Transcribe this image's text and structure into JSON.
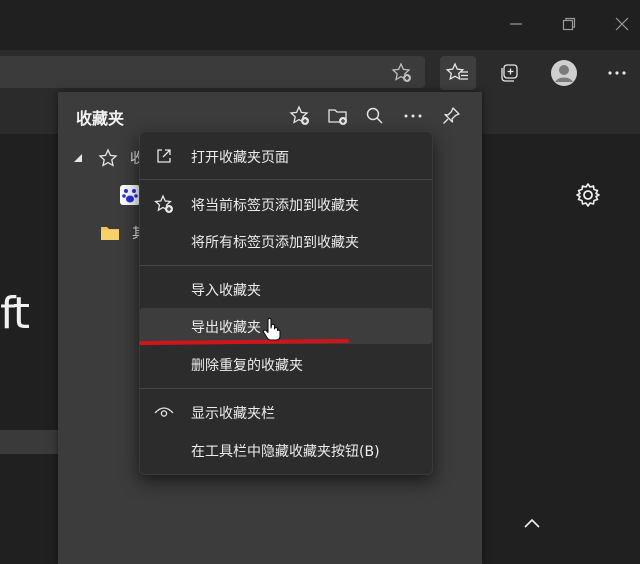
{
  "favorites_panel": {
    "title": "收藏夹",
    "tree": [
      {
        "label": "收"
      },
      {
        "label": ""
      },
      {
        "label": "其"
      }
    ]
  },
  "menu": {
    "items": [
      {
        "label": "打开收藏夹页面",
        "icon": "open-external-icon"
      },
      {
        "label": "将当前标签页添加到收藏夹",
        "icon": "star-add-icon"
      },
      {
        "label": "将所有标签页添加到收藏夹",
        "icon": ""
      },
      {
        "label": "导入收藏夹",
        "icon": ""
      },
      {
        "label": "导出收藏夹",
        "icon": ""
      },
      {
        "label": "删除重复的收藏夹",
        "icon": ""
      },
      {
        "label": "显示收藏夹栏",
        "icon": "eye-icon"
      },
      {
        "label": "在工具栏中隐藏收藏夹按钮(B)",
        "icon": ""
      }
    ],
    "hovered_index": 4
  },
  "page": {
    "partial_text": "ft"
  },
  "colors": {
    "panel_bg": "#3c3c3c",
    "menu_bg": "#2c2c2c",
    "annotation_red": "#d0141a"
  }
}
